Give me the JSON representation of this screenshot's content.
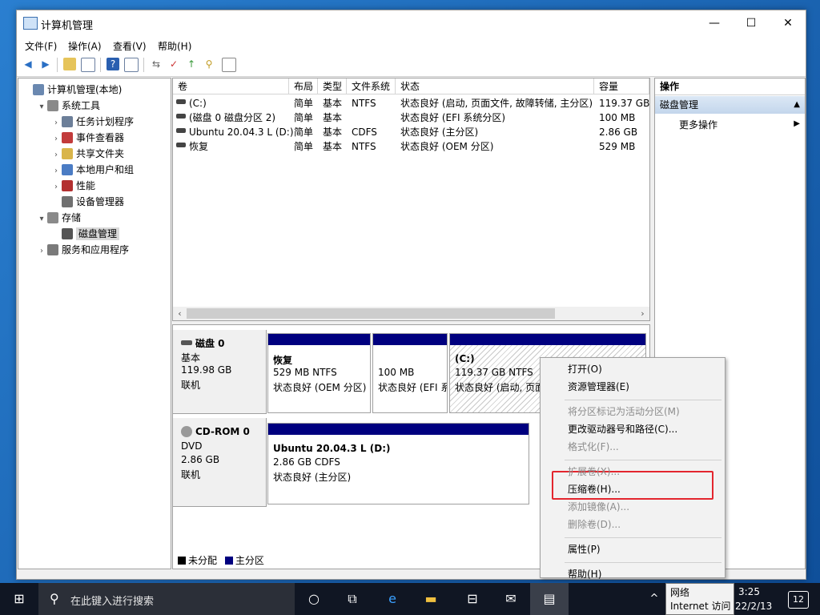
{
  "window": {
    "title": "计算机管理",
    "menu": [
      "文件(F)",
      "操作(A)",
      "查看(V)",
      "帮助(H)"
    ],
    "controls": {
      "minimize": "—",
      "maximize": "☐",
      "close": "✕"
    }
  },
  "tree": [
    {
      "label": "计算机管理(本地)",
      "indent": 0,
      "expander": "",
      "icon": "computer-icon",
      "color": "#6a88b0"
    },
    {
      "label": "系统工具",
      "indent": 1,
      "expander": "▾",
      "icon": "tools-icon",
      "color": "#8a8a8a"
    },
    {
      "label": "任务计划程序",
      "indent": 2,
      "expander": "›",
      "icon": "clock-icon",
      "color": "#6c7f99"
    },
    {
      "label": "事件查看器",
      "indent": 2,
      "expander": "›",
      "icon": "event-viewer-icon",
      "color": "#c23b3b"
    },
    {
      "label": "共享文件夹",
      "indent": 2,
      "expander": "›",
      "icon": "shared-folder-icon",
      "color": "#d9b54a"
    },
    {
      "label": "本地用户和组",
      "indent": 2,
      "expander": "›",
      "icon": "users-icon",
      "color": "#4b7cc4"
    },
    {
      "label": "性能",
      "indent": 2,
      "expander": "›",
      "icon": "performance-icon",
      "color": "#b33030"
    },
    {
      "label": "设备管理器",
      "indent": 2,
      "expander": "",
      "icon": "device-manager-icon",
      "color": "#707070"
    },
    {
      "label": "存储",
      "indent": 1,
      "expander": "▾",
      "icon": "storage-icon",
      "color": "#8a8a8a"
    },
    {
      "label": "磁盘管理",
      "indent": 2,
      "expander": "",
      "icon": "disk-icon",
      "color": "#555555",
      "selected": true
    },
    {
      "label": "服务和应用程序",
      "indent": 1,
      "expander": "›",
      "icon": "services-icon",
      "color": "#7a7a7a"
    }
  ],
  "volume_table": {
    "columns": [
      "卷",
      "布局",
      "类型",
      "文件系统",
      "状态",
      "容量"
    ],
    "rows": [
      [
        "(C:)",
        "简单",
        "基本",
        "NTFS",
        "状态良好 (启动, 页面文件, 故障转储, 主分区)",
        "119.37 GB"
      ],
      [
        "(磁盘 0 磁盘分区 2)",
        "简单",
        "基本",
        "",
        "状态良好 (EFI 系统分区)",
        "100 MB"
      ],
      [
        "Ubuntu 20.04.3 L (D:)",
        "简单",
        "基本",
        "CDFS",
        "状态良好 (主分区)",
        "2.86 GB"
      ],
      [
        "恢复",
        "简单",
        "基本",
        "NTFS",
        "状态良好 (OEM 分区)",
        "529 MB"
      ]
    ],
    "scroll_left": "‹",
    "scroll_right": "›"
  },
  "disks": [
    {
      "name": "磁盘 0",
      "type": "基本",
      "size": "119.98 GB",
      "status": "联机",
      "partitions": [
        {
          "name": "恢复",
          "detail": "529 MB NTFS",
          "status": "状态良好 (OEM 分区)"
        },
        {
          "name": "",
          "detail": "100 MB",
          "status": "状态良好 (EFI 系"
        },
        {
          "name": "(C:)",
          "detail": "119.37 GB NTFS",
          "status": "状态良好 (启动, 页面"
        }
      ]
    },
    {
      "name": "CD-ROM 0",
      "type": "DVD",
      "size": "2.86 GB",
      "status": "联机",
      "partitions": [
        {
          "name": "Ubuntu 20.04.3 L  (D:)",
          "detail": "2.86 GB CDFS",
          "status": "状态良好 (主分区)"
        }
      ]
    }
  ],
  "legend": [
    {
      "label": "未分配",
      "color": "#000000"
    },
    {
      "label": "主分区",
      "color": "#00007f"
    }
  ],
  "actions": {
    "header": "操作",
    "selected": "磁盘管理",
    "more": "更多操作"
  },
  "context_menu": [
    {
      "label": "打开(O)",
      "enabled": true
    },
    {
      "label": "资源管理器(E)",
      "enabled": true
    },
    {
      "sep": true
    },
    {
      "label": "将分区标记为活动分区(M)",
      "enabled": false
    },
    {
      "label": "更改驱动器号和路径(C)...",
      "enabled": true
    },
    {
      "label": "格式化(F)...",
      "enabled": false
    },
    {
      "sep": true
    },
    {
      "label": "扩展卷(X)...",
      "enabled": false
    },
    {
      "label": "压缩卷(H)...",
      "enabled": true,
      "highlighted": true
    },
    {
      "label": "添加镜像(A)...",
      "enabled": false
    },
    {
      "label": "删除卷(D)...",
      "enabled": false
    },
    {
      "sep": true
    },
    {
      "label": "属性(P)",
      "enabled": true
    },
    {
      "sep": true
    },
    {
      "label": "帮助(H)",
      "enabled": true
    }
  ],
  "taskbar": {
    "search_placeholder": "在此键入进行搜索",
    "tooltip_title": "网络",
    "tooltip_text": "Internet 访问",
    "time": "3:25",
    "date": "22/2/13",
    "notification_count": "12",
    "tray_chevron": "^"
  },
  "colors": {
    "primary_partition": "#00007f",
    "highlight_box": "#e3262e",
    "taskbar": "#101623"
  }
}
